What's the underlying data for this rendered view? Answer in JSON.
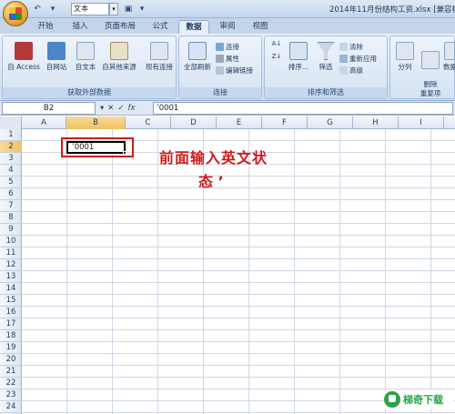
{
  "window": {
    "title": "2014年11月份结构工资.xlsx  [兼容模"
  },
  "quick_access": {
    "font_name": "文本"
  },
  "tabs": [
    {
      "label": "开始"
    },
    {
      "label": "插入"
    },
    {
      "label": "页面布局"
    },
    {
      "label": "公式"
    },
    {
      "label": "数据",
      "active": true
    },
    {
      "label": "审阅"
    },
    {
      "label": "视图"
    }
  ],
  "ribbon": {
    "group_external": {
      "label": "获取外部数据",
      "buttons": [
        {
          "label": "自 Access",
          "icon": "access-icon"
        },
        {
          "label": "自网站",
          "icon": "web-icon"
        },
        {
          "label": "自文本",
          "icon": "text-file-icon"
        },
        {
          "label": "自其他来源",
          "icon": "other-source-icon"
        },
        {
          "label": "现有连接",
          "icon": "existing-connection-icon"
        }
      ]
    },
    "group_connections": {
      "label": "连接",
      "refresh_label": "全部刷新",
      "small": [
        {
          "label": "连接",
          "icon": "connection-icon"
        },
        {
          "label": "属性",
          "icon": "properties-icon"
        },
        {
          "label": "编辑链接",
          "icon": "edit-link-icon"
        }
      ]
    },
    "group_sort": {
      "label": "排序和筛选",
      "sort_label": "排序...",
      "filter_label": "筛选",
      "small": [
        {
          "label": "清除",
          "icon": "clear-icon"
        },
        {
          "label": "重新应用",
          "icon": "reapply-icon"
        },
        {
          "label": "高级",
          "icon": "advanced-icon"
        }
      ]
    },
    "group_tools": {
      "buttons": [
        {
          "label": "分列",
          "icon": "split-column-icon"
        },
        {
          "label": "删除\n重复项",
          "icon": "remove-duplicates-icon"
        },
        {
          "label": "数据有效",
          "icon": "data-validation-icon"
        }
      ]
    }
  },
  "formula_bar": {
    "name_box": "B2",
    "fx_symbol": "fx",
    "value": "’0001"
  },
  "sheet": {
    "columns": [
      "A",
      "B",
      "C",
      "D",
      "E",
      "F",
      "G",
      "H",
      "I"
    ],
    "rows": [
      "1",
      "2",
      "3",
      "4",
      "5",
      "6",
      "7",
      "8",
      "9",
      "10",
      "11",
      "12",
      "13",
      "14",
      "15",
      "16",
      "17",
      "18",
      "19",
      "20",
      "21",
      "22",
      "23",
      "24"
    ],
    "active_cell": "B2",
    "active_value": "’0001"
  },
  "annotation": {
    "line1": "前面输入英文状",
    "line2": "态  ’"
  },
  "watermark": {
    "text": "梯奇下载"
  }
}
